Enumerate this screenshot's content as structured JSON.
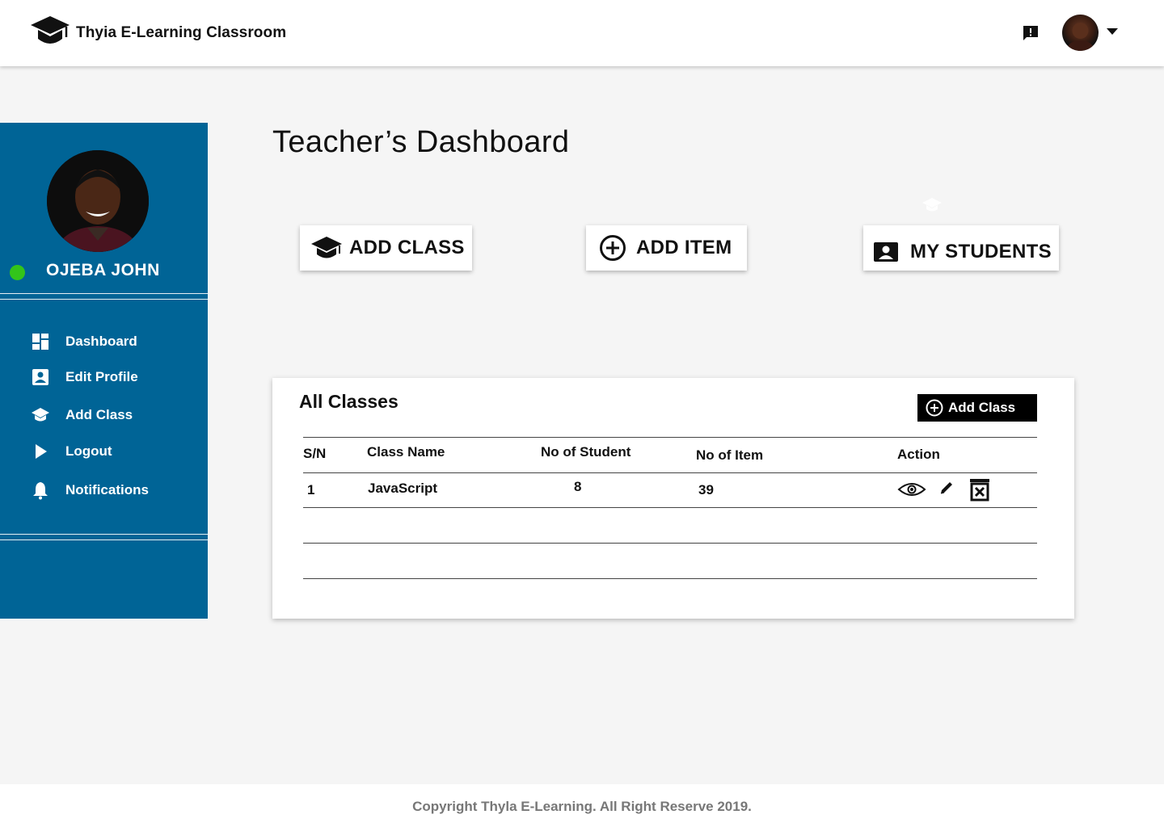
{
  "header": {
    "brand_name": "Thyia E-Learning Classroom",
    "logo_icon": "graduation-cap-icon",
    "feedback_icon": "feedback-icon",
    "menu_icon": "caret-down-icon"
  },
  "sidebar": {
    "profile_name": "OJEBA JOHN",
    "status": "online",
    "status_color": "#33c41a",
    "background_color": "#006496",
    "items": [
      {
        "label": "Dashboard",
        "icon": "dashboard-icon"
      },
      {
        "label": "Edit Profile",
        "icon": "contact-card-icon"
      },
      {
        "label": "Add Class",
        "icon": "graduation-cap-icon"
      },
      {
        "label": "Logout",
        "icon": "play-arrow-icon"
      },
      {
        "label": "Notifications",
        "icon": "bell-icon"
      }
    ]
  },
  "main": {
    "title": "Teacher’s Dashboard",
    "actions": [
      {
        "label": "ADD CLASS",
        "icon": "graduation-cap-icon"
      },
      {
        "label": "ADD ITEM",
        "icon": "plus-circle-icon"
      },
      {
        "label": "MY STUDENTS",
        "icon": "contact-card-icon"
      }
    ]
  },
  "classes": {
    "title": "All Classes",
    "add_button_label": "Add Class",
    "columns": [
      "S/N",
      "Class Name",
      "No of Student",
      "No of Item",
      "Action"
    ],
    "rows": [
      {
        "sn": "1",
        "class_name": "JavaScript",
        "students": "8",
        "items": "39",
        "actions": [
          "view-icon",
          "edit-icon",
          "delete-icon"
        ]
      }
    ]
  },
  "footer": {
    "copyright": "Copyright Thyla E-Learning. All Right Reserve 2019."
  }
}
